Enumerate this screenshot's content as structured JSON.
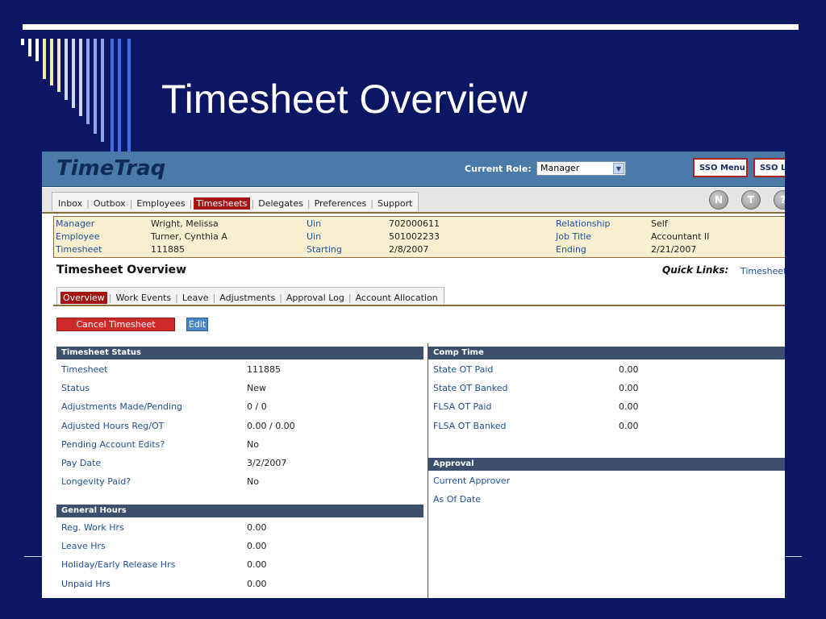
{
  "slide": {
    "title": "Timesheet Overview",
    "deco_colors": [
      "#ffffff",
      "#f3e7b3",
      "#cfd7f2",
      "#8fa5e8",
      "#3f6ee0"
    ]
  },
  "app": {
    "brand": "TimeTraq",
    "current_role_label": "Current Role:",
    "current_role_value": "Manager",
    "sso_menu_label": "SSO Menu",
    "sso_logout_label": "SSO Lo",
    "nav": {
      "items": [
        "Inbox",
        "Outbox",
        "Employees",
        "Timesheets",
        "Delegates",
        "Preferences",
        "Support"
      ],
      "active": "Timesheets"
    },
    "round_buttons": [
      "N",
      "T",
      "?"
    ],
    "info": {
      "rows": [
        {
          "l1": "Manager",
          "v1": "Wright, Melissa",
          "l2": "Uin",
          "v2": "702000611",
          "l3": "Relationship",
          "v3": "Self"
        },
        {
          "l1": "Employee",
          "v1": "Turner, Cynthia A",
          "l2": "Uin",
          "v2": "501002233",
          "l3": "Job Title",
          "v3": "Accountant II"
        },
        {
          "l1": "Timesheet",
          "v1": "111885",
          "l2": "Starting",
          "v2": "2/8/2007",
          "l3": "Ending",
          "v3": "2/21/2007"
        }
      ]
    },
    "overview_title": "Timesheet Overview",
    "quick_links_label": "Quick Links:",
    "quick_links_value": "Timesheet",
    "sub_tabs": {
      "items": [
        "Overview",
        "Work Events",
        "Leave",
        "Adjustments",
        "Approval Log",
        "Account Allocation"
      ],
      "active": "Overview"
    },
    "cancel_button": "Cancel Timesheet",
    "edit_button": "Edit",
    "timesheet_status": {
      "header": "Timesheet Status",
      "rows": [
        {
          "label": "Timesheet",
          "value": "111885"
        },
        {
          "label": "Status",
          "value": "New"
        },
        {
          "label": "Adjustments Made/Pending",
          "value": "0 / 0"
        },
        {
          "label": "Adjusted Hours Reg/OT",
          "value": "0.00 / 0.00"
        },
        {
          "label": "Pending Account Edits?",
          "value": "No"
        },
        {
          "label": "Pay Date",
          "value": "3/2/2007"
        },
        {
          "label": "Longevity Paid?",
          "value": "No"
        }
      ]
    },
    "general_hours": {
      "header": "General Hours",
      "rows": [
        {
          "label": "Reg. Work Hrs",
          "value": "0.00"
        },
        {
          "label": "Leave Hrs",
          "value": "0.00"
        },
        {
          "label": "Holiday/Early Release Hrs",
          "value": "0.00"
        },
        {
          "label": "Unpaid Hrs",
          "value": "0.00"
        }
      ]
    },
    "comp_time": {
      "header": "Comp Time",
      "rows": [
        {
          "label": "State OT Paid",
          "value": "0.00"
        },
        {
          "label": "State OT Banked",
          "value": "0.00"
        },
        {
          "label": "FLSA OT Paid",
          "value": "0.00"
        },
        {
          "label": "FLSA OT Banked",
          "value": "0.00"
        }
      ]
    },
    "approval": {
      "header": "Approval",
      "rows": [
        {
          "label": "Current Approver",
          "value": ""
        },
        {
          "label": "As Of Date",
          "value": ""
        }
      ]
    }
  }
}
